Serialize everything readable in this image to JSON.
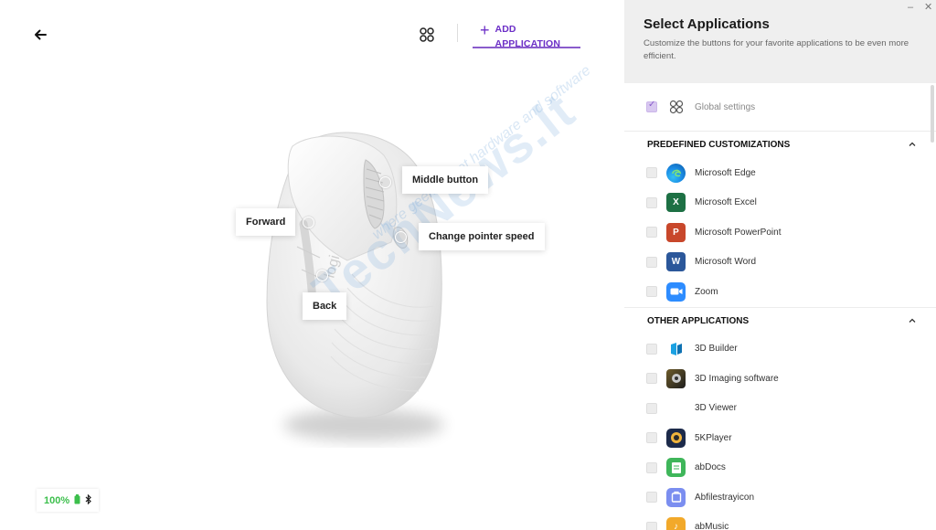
{
  "header": {
    "add_application_label": "ADD APPLICATION"
  },
  "callouts": {
    "middle_button": "Middle button",
    "forward": "Forward",
    "change_pointer_speed": "Change pointer speed",
    "back": "Back"
  },
  "watermark": {
    "brand": "TechNews.lt",
    "tagline": "where geeks meet hardware and software"
  },
  "battery": {
    "percent": "100%"
  },
  "panel": {
    "title": "Select Applications",
    "description": "Customize the buttons for your favorite applications to be even more efficient.",
    "global_settings_label": "Global settings",
    "sections": [
      {
        "title": "PREDEFINED CUSTOMIZATIONS",
        "items": [
          {
            "name": "Microsoft Edge",
            "icon": "edge-icon"
          },
          {
            "name": "Microsoft Excel",
            "icon": "excel-icon"
          },
          {
            "name": "Microsoft PowerPoint",
            "icon": "powerpoint-icon"
          },
          {
            "name": "Microsoft Word",
            "icon": "word-icon"
          },
          {
            "name": "Zoom",
            "icon": "zoom-icon"
          }
        ]
      },
      {
        "title": "OTHER APPLICATIONS",
        "items": [
          {
            "name": "3D Builder",
            "icon": "3d-builder-icon"
          },
          {
            "name": "3D Imaging software",
            "icon": "3d-imaging-icon"
          },
          {
            "name": "3D Viewer",
            "icon": "3d-viewer-icon"
          },
          {
            "name": "5KPlayer",
            "icon": "5kplayer-icon"
          },
          {
            "name": "abDocs",
            "icon": "abdocs-icon"
          },
          {
            "name": "Abfilestrayicon",
            "icon": "abfilestray-icon"
          },
          {
            "name": "abMusic",
            "icon": "abmusic-icon"
          }
        ]
      }
    ]
  },
  "colors": {
    "accent": "#6c2fc7",
    "battery_green": "#3cbf4c",
    "panel_header_bg": "#efefef"
  }
}
